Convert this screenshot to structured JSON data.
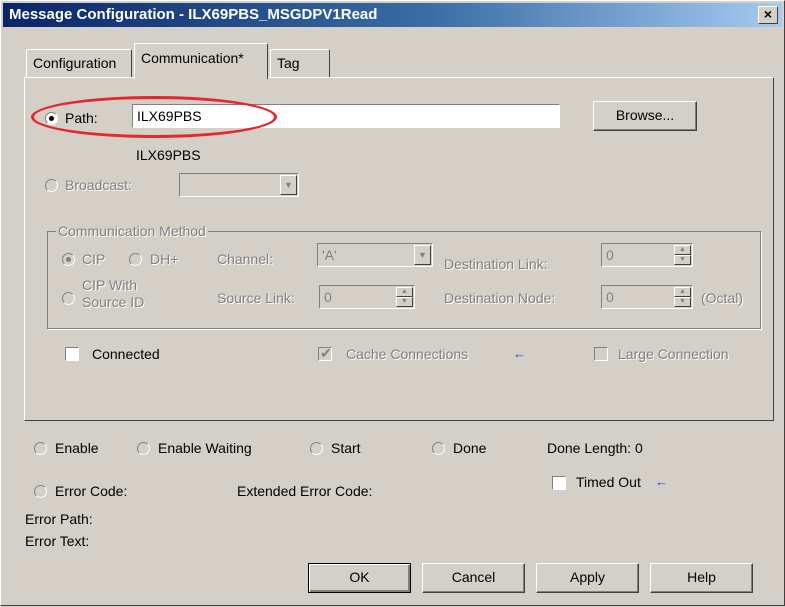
{
  "window": {
    "title": "Message Configuration - ILX69PBS_MSGDPV1Read",
    "close_label": "×"
  },
  "tabs": [
    {
      "label": "Configuration",
      "active": false
    },
    {
      "label": "Communication*",
      "active": true
    },
    {
      "label": "Tag",
      "active": false
    }
  ],
  "path": {
    "label": "Path:",
    "value": "ILX69PBS",
    "resolved": "ILX69PBS",
    "browse_label": "Browse..."
  },
  "broadcast": {
    "label": "Broadcast:",
    "value": ""
  },
  "communication_method": {
    "title": "Communication Method",
    "cip_label": "CIP",
    "dhplus_label": "DH+",
    "channel_label": "Channel:",
    "channel_value": "'A'",
    "destination_link_label": "Destination Link:",
    "destination_link_value": "0",
    "cip_source_label_1": "CIP With",
    "cip_source_label_2": "Source ID",
    "source_link_label": "Source Link:",
    "source_link_value": "0",
    "destination_node_label": "Destination Node:",
    "destination_node_value": "0",
    "octal_label": "(Octal)"
  },
  "options": {
    "connected_label": "Connected",
    "connected_checked": false,
    "cache_label": "Cache Connections",
    "cache_checked": true,
    "large_label": "Large Connection",
    "large_checked": false
  },
  "status": {
    "enable_label": "Enable",
    "enable_waiting_label": "Enable Waiting",
    "start_label": "Start",
    "done_label": "Done",
    "done_length_label": "Done Length: 0",
    "error_code_label": "Error Code:",
    "extended_error_label": "Extended Error Code:",
    "timed_out_label": "Timed Out",
    "error_path_label": "Error Path:",
    "error_text_label": "Error Text:"
  },
  "buttons": {
    "ok": "OK",
    "cancel": "Cancel",
    "apply": "Apply",
    "help": "Help"
  },
  "colors": {
    "title_bar": "#0a246a",
    "highlight_ellipse": "#e8242c",
    "arrow": "#1f3fcf"
  }
}
